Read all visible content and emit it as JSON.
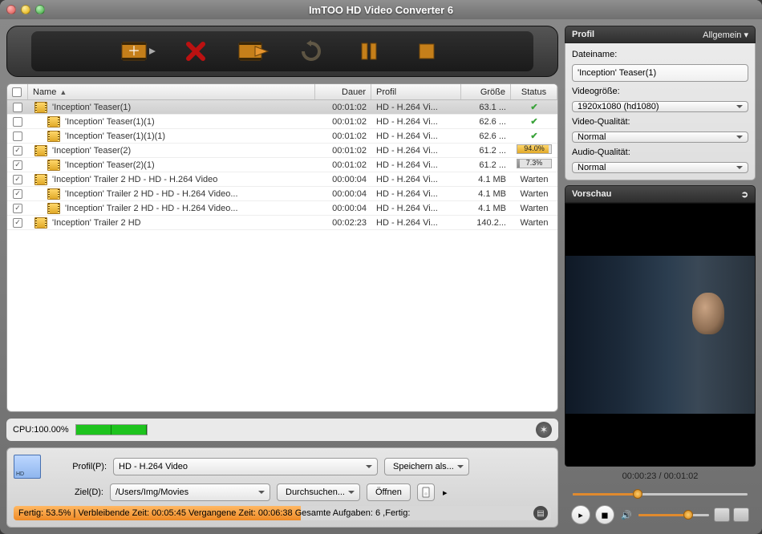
{
  "window": {
    "title": "ImTOO HD Video Converter 6"
  },
  "toolbar": {
    "add": "add",
    "remove": "remove",
    "convert": "convert",
    "undo": "undo",
    "pause": "pause",
    "stop": "stop"
  },
  "columns": {
    "name": "Name",
    "duration": "Dauer",
    "profile": "Profil",
    "size": "Größe",
    "status": "Status"
  },
  "rows": [
    {
      "checked": false,
      "indent": 0,
      "name": "'Inception' Teaser(1)",
      "selected": true,
      "dur": "00:01:02",
      "prof": "HD - H.264 Vi...",
      "size": "63.1 ...",
      "status": "ok",
      "pct": null
    },
    {
      "checked": false,
      "indent": 1,
      "name": "'Inception' Teaser(1)(1)",
      "selected": false,
      "dur": "00:01:02",
      "prof": "HD - H.264 Vi...",
      "size": "62.6 ...",
      "status": "ok",
      "pct": null
    },
    {
      "checked": false,
      "indent": 1,
      "name": "'Inception' Teaser(1)(1)(1)",
      "selected": false,
      "dur": "00:01:02",
      "prof": "HD - H.264 Vi...",
      "size": "62.6 ...",
      "status": "ok",
      "pct": null
    },
    {
      "checked": true,
      "indent": 0,
      "name": "'Inception' Teaser(2)",
      "selected": false,
      "dur": "00:01:02",
      "prof": "HD - H.264 Vi...",
      "size": "61.2 ...",
      "status": "prog",
      "pct": 94.0
    },
    {
      "checked": true,
      "indent": 1,
      "name": "'Inception' Teaser(2)(1)",
      "selected": false,
      "dur": "00:01:02",
      "prof": "HD - H.264 Vi...",
      "size": "61.2 ...",
      "status": "grey",
      "pct": 7.3
    },
    {
      "checked": true,
      "indent": 0,
      "name": "'Inception' Trailer 2 HD - HD - H.264 Video",
      "selected": false,
      "dur": "00:00:04",
      "prof": "HD - H.264 Vi...",
      "size": "4.1 MB",
      "status": "wait",
      "pct": null
    },
    {
      "checked": true,
      "indent": 1,
      "name": "'Inception' Trailer 2 HD - HD - H.264 Video...",
      "selected": false,
      "dur": "00:00:04",
      "prof": "HD - H.264 Vi...",
      "size": "4.1 MB",
      "status": "wait",
      "pct": null
    },
    {
      "checked": true,
      "indent": 1,
      "name": "'Inception' Trailer 2 HD - HD - H.264 Video...",
      "selected": false,
      "dur": "00:00:04",
      "prof": "HD - H.264 Vi...",
      "size": "4.1 MB",
      "status": "wait",
      "pct": null
    },
    {
      "checked": true,
      "indent": 0,
      "name": "'Inception' Trailer 2 HD",
      "selected": false,
      "dur": "00:02:23",
      "prof": "HD - H.264 Vi...",
      "size": "140.2...",
      "status": "wait",
      "pct": null
    }
  ],
  "status_wait": "Warten",
  "cpu": {
    "label": "CPU:100.00%",
    "cores": [
      50,
      50
    ]
  },
  "bottom": {
    "profile_label": "Profil(P):",
    "profile_value": "HD - H.264 Video",
    "save_as": "Speichern als...",
    "dest_label": "Ziel(D):",
    "dest_value": "/Users/Img/Movies",
    "browse": "Durchsuchen...",
    "open": "Öffnen"
  },
  "statusline": {
    "pct": 53.5,
    "text": "Fertig: 53.5% | Verbleibende Zeit: 00:05:45 Vergangene Zeit: 00:06:38 Gesamte Aufgaben: 6 ,Fertig:"
  },
  "profile_panel": {
    "title": "Profil",
    "mode": "Allgemein",
    "filename_label": "Dateiname:",
    "filename": "'Inception' Teaser(1)",
    "videosize_label": "Videogröße:",
    "videosize": "1920x1080 (hd1080)",
    "vq_label": "Video-Qualität:",
    "vq": "Normal",
    "aq_label": "Audio-Qualität:",
    "aq": "Normal"
  },
  "preview": {
    "title": "Vorschau",
    "time": "00:00:23 / 00:01:02",
    "pos_pct": 37,
    "vol_pct": 70
  }
}
